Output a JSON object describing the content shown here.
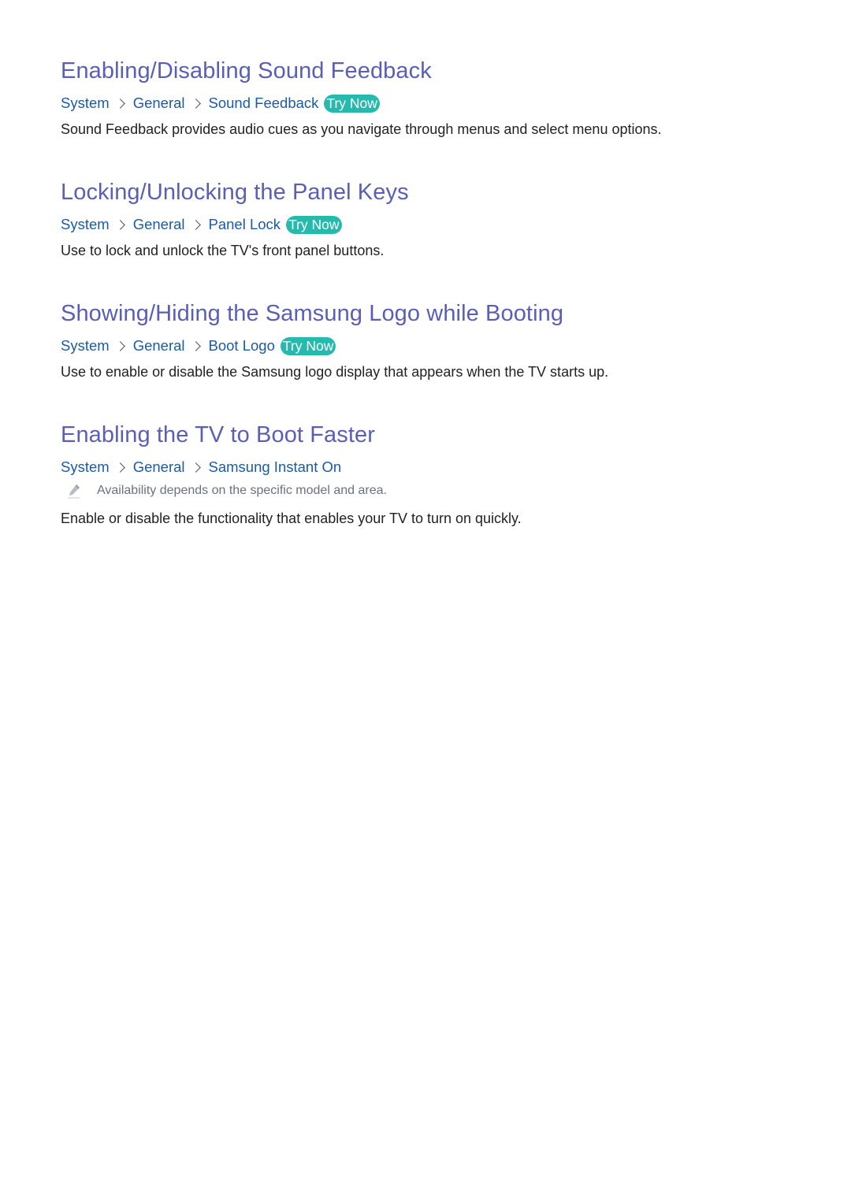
{
  "sections": [
    {
      "title": "Enabling/Disabling Sound Feedback",
      "breadcrumb": [
        "System",
        "General",
        "Sound Feedback"
      ],
      "try_now": "Try Now",
      "description": "Sound Feedback provides audio cues as you navigate through menus and select menu options."
    },
    {
      "title": "Locking/Unlocking the Panel Keys",
      "breadcrumb": [
        "System",
        "General",
        "Panel Lock"
      ],
      "try_now": "Try Now",
      "description": "Use to lock and unlock the TV's front panel buttons."
    },
    {
      "title": "Showing/Hiding the Samsung Logo while Booting",
      "breadcrumb": [
        "System",
        "General",
        "Boot Logo"
      ],
      "try_now": "Try Now",
      "description": "Use to enable or disable the Samsung logo display that appears when the TV starts up."
    },
    {
      "title": "Enabling the TV to Boot Faster",
      "breadcrumb": [
        "System",
        "General",
        "Samsung Instant On"
      ],
      "note": "Availability depends on the specific model and area.",
      "description": "Enable or disable the functionality that enables your TV to turn on quickly."
    }
  ],
  "icons": {
    "separator": "chevron-right-icon",
    "note": "pencil-icon"
  },
  "colors": {
    "heading": "#5a5fb5",
    "breadcrumb": "#1b5ba6",
    "try_now_bg": "#26b9ad",
    "body": "#222222",
    "note": "#6c7080"
  }
}
